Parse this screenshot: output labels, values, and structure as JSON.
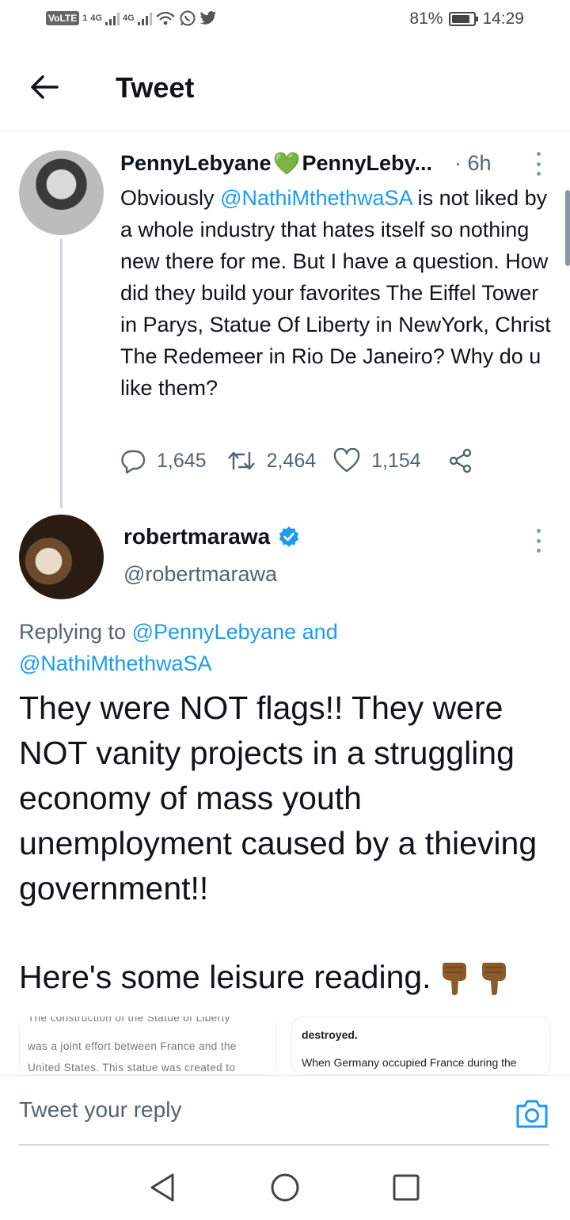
{
  "status_bar": {
    "volte": "VoLTE",
    "sim1": "1",
    "net1": "4G",
    "net2": "4G",
    "battery": "81%",
    "time": "14:29"
  },
  "header": {
    "title": "Tweet"
  },
  "tweet1": {
    "display_name": "PennyLebyane",
    "name_emoji": "💚",
    "handle": "PennyLeby...",
    "time": "· 6h",
    "text_before": "Obviously ",
    "mention": "@NathiMthethwaSA",
    "text_after": " is not liked by a whole industry that hates itself so nothing new there for me. But I have a question. How did they build your favorites The Eiffel Tower in Parys, Statue Of Liberty in NewYork, Christ The Redemeer in Rio De Janeiro?  Why do u like them?",
    "replies": "1,645",
    "retweets": "2,464",
    "likes": "1,154"
  },
  "tweet2": {
    "display_name": "robertmarawa",
    "handle": "@robertmarawa",
    "replying_label": "Replying to ",
    "replying_mention1": "@PennyLebyane",
    "replying_and": " and",
    "replying_mention2": "@NathiMthethwaSA",
    "body": "They were NOT flags!! They were NOT vanity projects in a struggling economy of mass youth unemployment caused by a thieving government!!",
    "body2": "Here's some leisure reading.",
    "media_left_lines": [
      "The construction of the Statue of Liberty",
      "was a joint effort between France and the",
      "United States. This statue was created to"
    ],
    "media_right_lines": [
      "destroyed.",
      "When Germany occupied France during the"
    ]
  },
  "reply_bar": {
    "placeholder": "Tweet your reply"
  },
  "colors": {
    "link": "#1d9bf0",
    "secondary_text": "#536471",
    "verified": "#1d9bf0"
  }
}
